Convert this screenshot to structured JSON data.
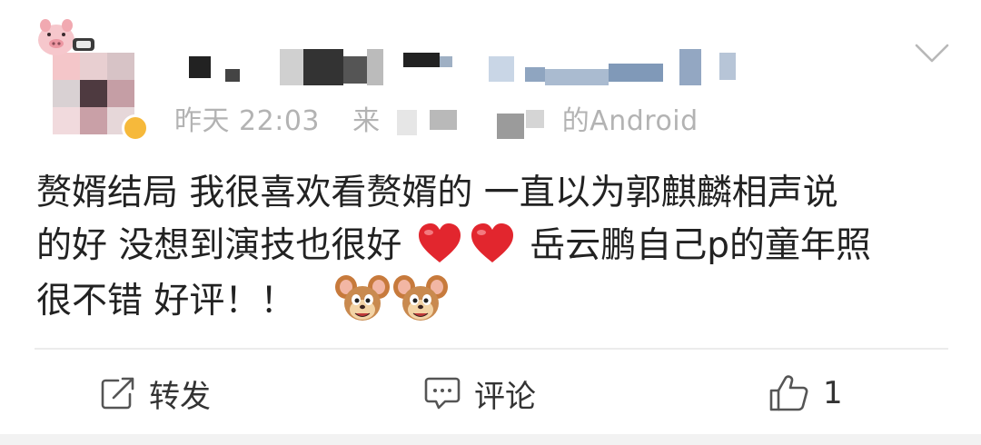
{
  "post": {
    "time": "昨天 22:03",
    "source_prefix": "来",
    "source_suffix": "的Android",
    "content": {
      "line1": "赘婿结局 我很喜欢看赘婿的 一直以为郭麒麟相声说",
      "line2a": "的好 没想到演技也很好",
      "line2b": "岳云鹏自己p的童年照",
      "line3": "很不错 好评！！"
    }
  },
  "actions": {
    "repost_label": "转发",
    "comment_label": "评论",
    "like_count": "1"
  },
  "colors": {
    "meta_gray": "#b3b3b3",
    "heart_red": "#e2262e",
    "verified_gold": "#f6b93b"
  },
  "icons": [
    "chevron-down-icon",
    "heart-icon",
    "jerry-emoji-icon",
    "repost-icon",
    "comment-icon",
    "like-icon"
  ]
}
